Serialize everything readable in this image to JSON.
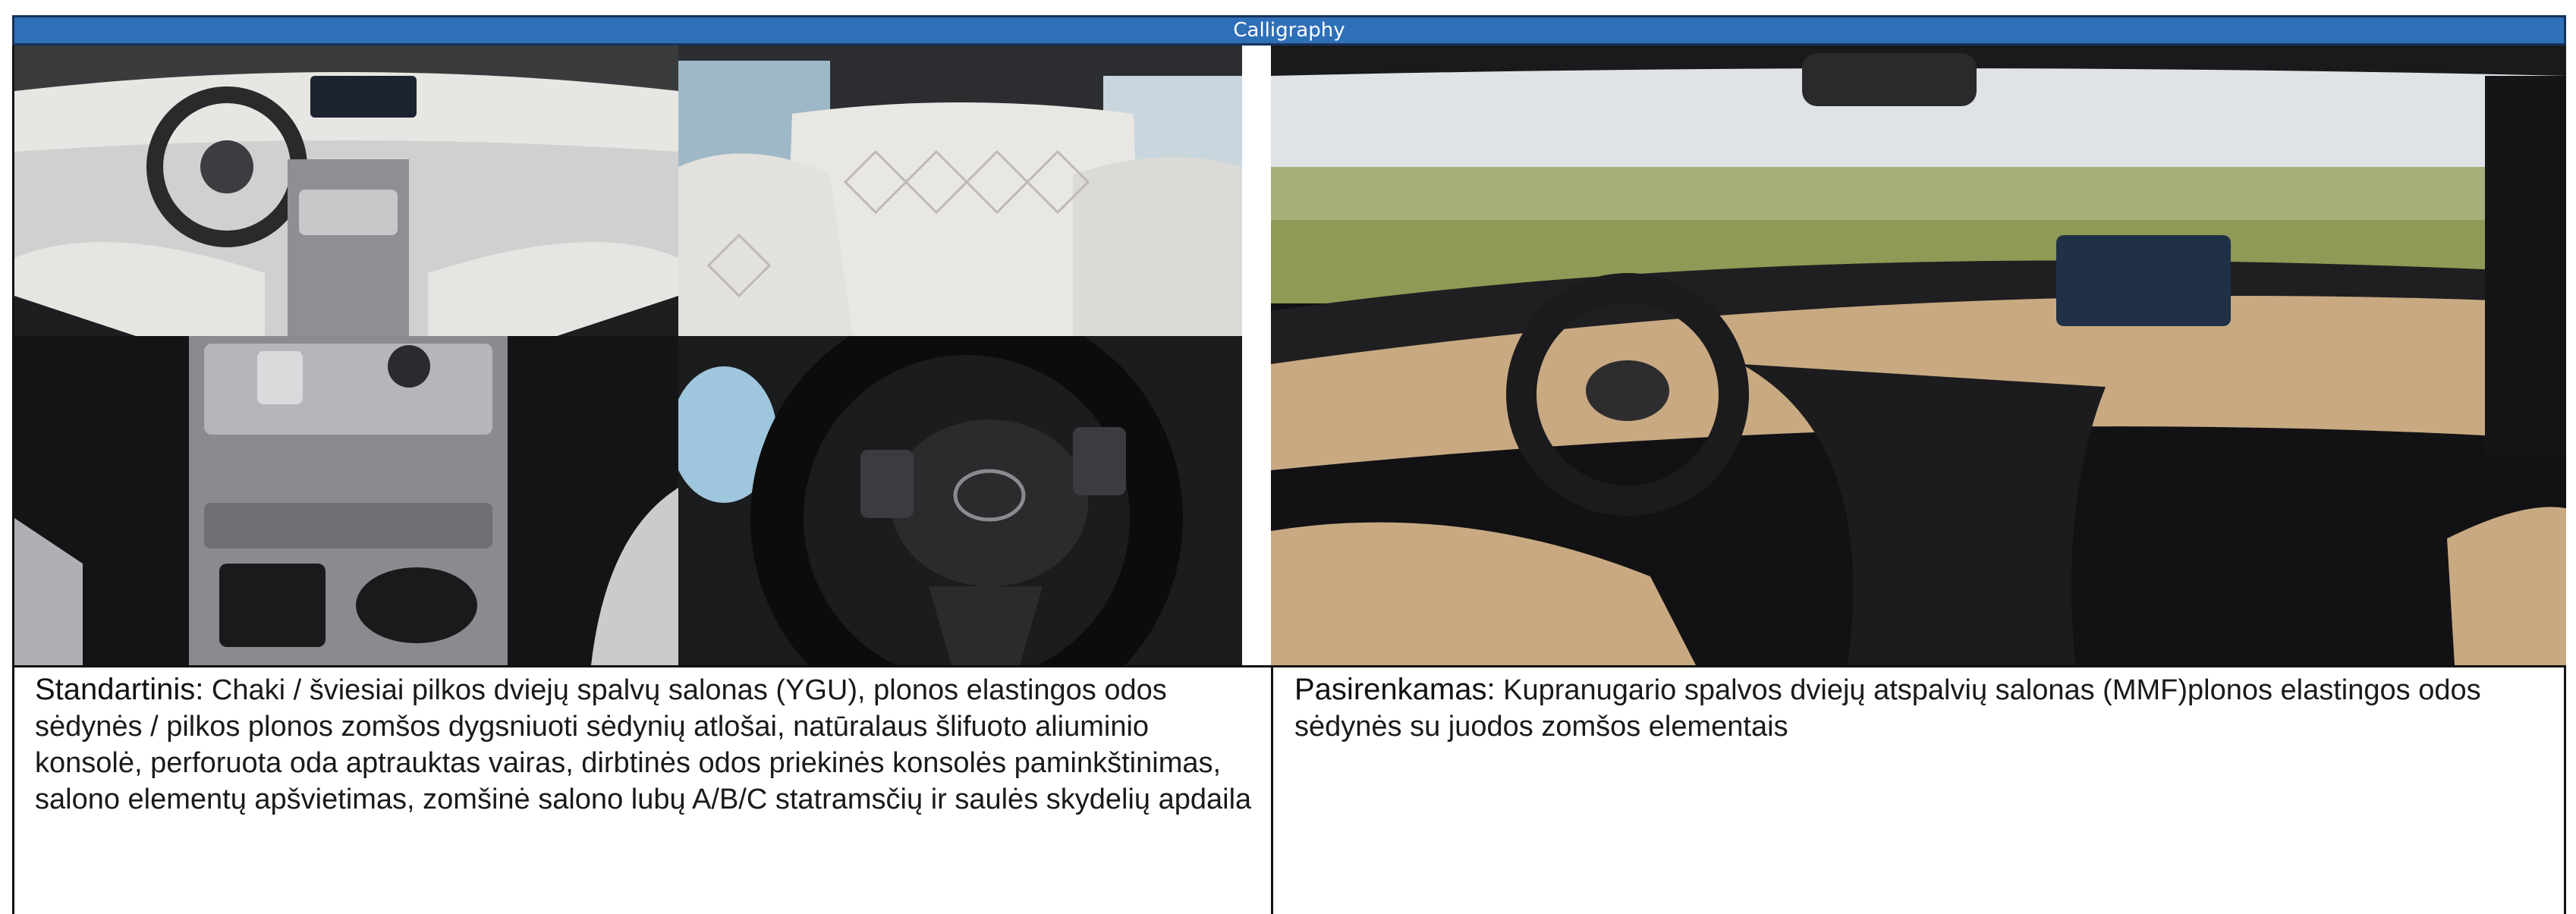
{
  "header": {
    "title": "Calligraphy"
  },
  "images": [
    {
      "name": "dashboard-overview-photo",
      "subject": "light grey interior dashboard and front seats"
    },
    {
      "name": "rear-seats-photo",
      "subject": "quilted light grey rear seats"
    },
    {
      "name": "center-console-photo",
      "subject": "aluminium centre console with gear buttons and cup holders"
    },
    {
      "name": "steering-wheel-photo",
      "subject": "leather steering wheel with Hyundai logo"
    },
    {
      "name": "beige-interior-photo",
      "subject": "beige two-tone dashboard with navigation screen"
    }
  ],
  "standard": {
    "label": "Standartinis:",
    "text": "Chaki / šviesiai pilkos dviejų spalvų salonas (YGU), plonos elastingos odos sėdynės / pilkos plonos zomšos dygsniuoti sėdynių atlošai, natūralaus šlifuoto aliuminio konsolė, perforuota oda aptrauktas vairas, dirbtinės odos priekinės konsolės paminkštinimas, salono elementų apšvietimas, zomšinė salono lubų A/B/C statramsčių ir saulės skydelių apdaila"
  },
  "optional": {
    "label": "Pasirenkamas:",
    "text": "Kupranugario spalvos dviejų atspalvių salonas (MMF)plonos elastingos odos sėdynės su juodos zomšos elementais"
  },
  "colors": {
    "title_bar": "#2f6fb7",
    "title_border": "#16325a",
    "text": "#1a1a1a",
    "beige": "#c8a982"
  }
}
